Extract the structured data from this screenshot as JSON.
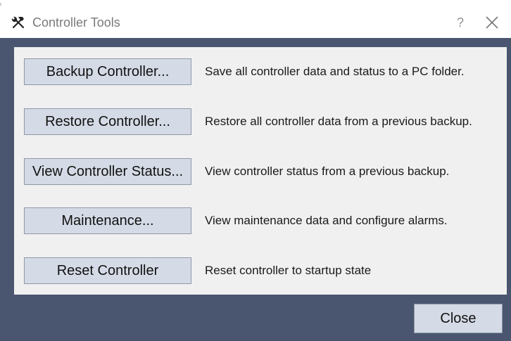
{
  "window": {
    "title": "Controller Tools",
    "icon": "tools-icon",
    "help_label": "?",
    "close_icon": "close-icon"
  },
  "tools": [
    {
      "label": "Backup Controller...",
      "description": "Save all controller data and status to a PC folder."
    },
    {
      "label": "Restore Controller...",
      "description": "Restore all controller data from a previous backup."
    },
    {
      "label": "View Controller Status...",
      "description": "View controller status from a previous backup."
    },
    {
      "label": "Maintenance...",
      "description": "View maintenance data and configure alarms."
    },
    {
      "label": "Reset Controller",
      "description": "Reset controller to startup state"
    }
  ],
  "footer": {
    "close_label": "Close"
  },
  "colors": {
    "frame": "#4a5570",
    "panel": "#f0f0f0",
    "button": "#d5dbe6",
    "button_border": "#8f97a8"
  }
}
